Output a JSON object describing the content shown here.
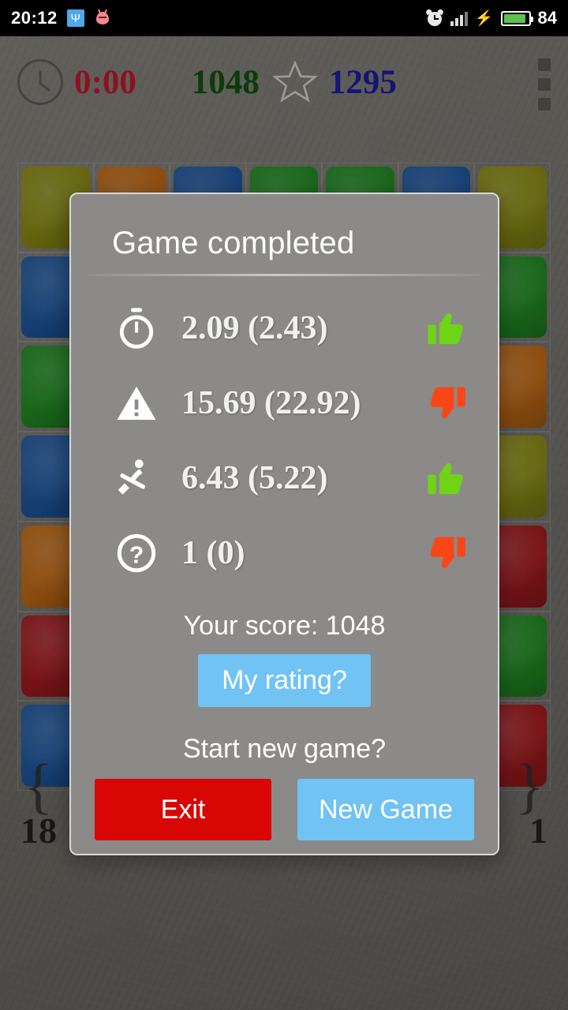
{
  "status_bar": {
    "time": "20:12",
    "battery_percent": "84",
    "icons": [
      "usb-icon",
      "bug-icon",
      "alarm-icon",
      "signal-icon",
      "charging-bolt-icon",
      "battery-icon"
    ]
  },
  "game_header": {
    "timer": "0:00",
    "score": "1048",
    "best_score": "1295",
    "timer_color": "#bf1226",
    "score_color": "#0a4d0a",
    "best_color": "#13179e",
    "menu_icon": "overflow-menu-icon"
  },
  "board": {
    "bottom_left_number": "18",
    "bottom_right_number": "1",
    "rows": [
      [
        "#8a8a0e",
        "#c2660d",
        "#17539e",
        "#1a8a1c",
        "#1a8a1c",
        "#17539e",
        "#8a8a0e"
      ],
      [
        "#17539e",
        "#8b8a88",
        "#8b8a88",
        "#8b8a88",
        "#8b8a88",
        "#8b8a88",
        "#1a8a1c"
      ],
      [
        "#1a8a1c",
        "#8b8a88",
        "#8b8a88",
        "#8b8a88",
        "#8b8a88",
        "#8b8a88",
        "#c2660d"
      ],
      [
        "#17539e",
        "#8b8a88",
        "#8b8a88",
        "#8b8a88",
        "#8b8a88",
        "#8b8a88",
        "#8a8a0e"
      ],
      [
        "#c2660d",
        "#8b8a88",
        "#8b8a88",
        "#8b8a88",
        "#8b8a88",
        "#8b8a88",
        "#a31318"
      ],
      [
        "#a31318",
        "#8b8a88",
        "#8b8a88",
        "#8b8a88",
        "#8b8a88",
        "#8b8a88",
        "#1a8a1c"
      ],
      [
        "#17539e",
        "#8b8a88",
        "#8b8a88",
        "#8b8a88",
        "#8b8a88",
        "#8b8a88",
        "#a31318"
      ]
    ]
  },
  "dialog": {
    "title": "Game completed",
    "stats": [
      {
        "icon": "stopwatch-icon",
        "value": "2.09 (2.43)",
        "verdict": "thumbs-up-icon",
        "verdict_color": "#6fd316"
      },
      {
        "icon": "warning-icon",
        "value": "15.69 (22.92)",
        "verdict": "thumbs-down-icon",
        "verdict_color": "#fa4616"
      },
      {
        "icon": "rower-icon",
        "value": "6.43 (5.22)",
        "verdict": "thumbs-up-icon",
        "verdict_color": "#6fd316"
      },
      {
        "icon": "question-icon",
        "value": "1 (0)",
        "verdict": "thumbs-down-icon",
        "verdict_color": "#fa4616"
      }
    ],
    "score_label": "Your score: 1048",
    "rating_button": "My rating?",
    "new_game_prompt": "Start new game?",
    "exit_button": "Exit",
    "new_game_button": "New Game",
    "accent_blue": "#70c3f3",
    "accent_red": "#d90606"
  }
}
